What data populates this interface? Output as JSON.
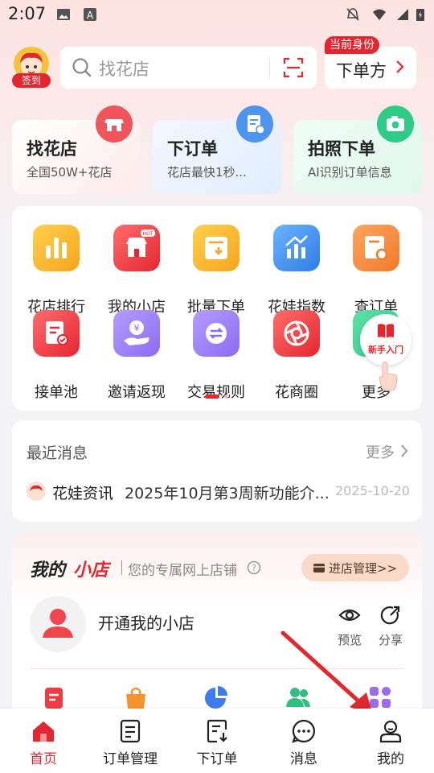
{
  "status_bar": {
    "time": "2:07"
  },
  "header": {
    "signin_label": "签到",
    "search_placeholder": "找花店",
    "role_badge": "当前身份",
    "role_value": "下单方"
  },
  "quick_cards": [
    {
      "title": "找花店",
      "subtitle": "全国50W+花店",
      "icon": "shop-icon"
    },
    {
      "title": "下订单",
      "subtitle": "花店最快1秒...",
      "icon": "order-clipboard-icon"
    },
    {
      "title": "拍照下单",
      "subtitle": "AI识别订单信息",
      "icon": "camera-icon"
    }
  ],
  "grid": [
    {
      "label": "花店排行",
      "icon": "ranking-icon"
    },
    {
      "label": "我的小店",
      "icon": "my-shop-icon"
    },
    {
      "label": "批量下单",
      "icon": "batch-order-icon"
    },
    {
      "label": "花娃指数",
      "icon": "index-chart-icon"
    },
    {
      "label": "查订单",
      "icon": "search-order-icon"
    },
    {
      "label": "接单池",
      "icon": "order-pool-icon"
    },
    {
      "label": "邀请返现",
      "icon": "invite-cashback-icon"
    },
    {
      "label": "交易规则",
      "icon": "exchange-rules-icon"
    },
    {
      "label": "花商圈",
      "icon": "aperture-icon"
    },
    {
      "label": "更多",
      "icon": "more-icon"
    }
  ],
  "beginner_label": "新手入门",
  "news": {
    "title": "最近消息",
    "more": "更多",
    "item_tag": "花娃资讯",
    "item_text": "2025年10月第3周新功能介...",
    "item_date": "2025-10-20"
  },
  "shop": {
    "logo_part1": "我的",
    "logo_part2": "小店",
    "desc": "您的专属网上店铺",
    "manage_btn": "进店管理>>",
    "open_text": "开通我的小店",
    "preview": "预览",
    "share": "分享"
  },
  "colors": {
    "accent": "#e5262f"
  },
  "bottom_nav": [
    {
      "label": "首页",
      "icon": "home-icon",
      "active": true
    },
    {
      "label": "订单管理",
      "icon": "order-list-icon"
    },
    {
      "label": "下订单",
      "icon": "place-order-icon"
    },
    {
      "label": "消息",
      "icon": "message-icon"
    },
    {
      "label": "我的",
      "icon": "profile-icon"
    }
  ]
}
